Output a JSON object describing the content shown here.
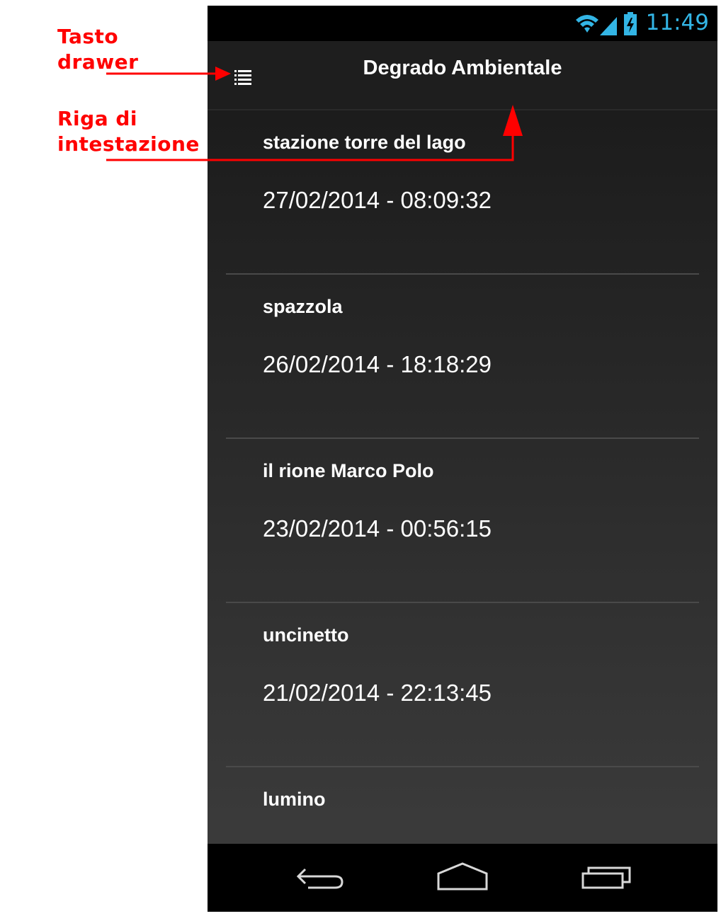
{
  "annotations": {
    "drawer_label_line1": "Tasto",
    "drawer_label_line2": "drawer",
    "header_label_line1": "Riga di",
    "header_label_line2": "intestazione",
    "color": "#ff0000"
  },
  "status_bar": {
    "time": "11:49",
    "icons": [
      "wifi-icon",
      "signal-icon",
      "battery-charging-icon"
    ],
    "accent": "#33b5e5"
  },
  "action_bar": {
    "title": "Degrado Ambientale",
    "drawer_icon": "drawer-list-icon"
  },
  "list": {
    "items": [
      {
        "name": "stazione torre del lago",
        "date": "27/02/2014 - 08:09:32"
      },
      {
        "name": "spazzola",
        "date": "26/02/2014 - 18:18:29"
      },
      {
        "name": "il rione Marco Polo",
        "date": "23/02/2014 - 00:56:15"
      },
      {
        "name": "uncinetto",
        "date": "21/02/2014 - 22:13:45"
      },
      {
        "name": "lumino",
        "date": ""
      }
    ]
  },
  "nav_bar": {
    "buttons": [
      "back-icon",
      "home-icon",
      "recents-icon"
    ]
  }
}
